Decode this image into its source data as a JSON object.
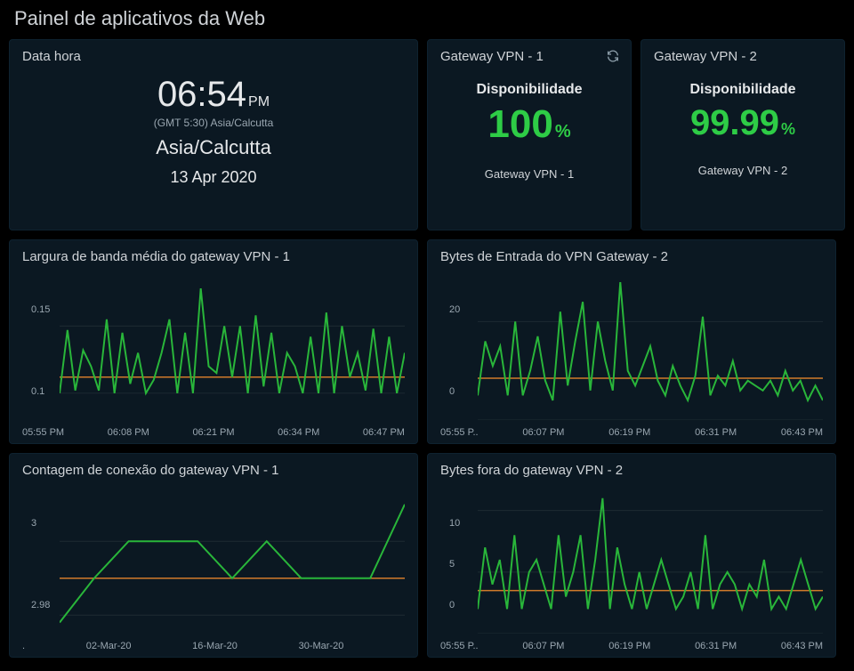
{
  "board_title": "Painel de aplicativos da Web",
  "clock": {
    "card_title": "Data hora",
    "time": "06:54",
    "ampm": "PM",
    "tz_line": "(GMT 5:30) Asia/Calcutta",
    "zone": "Asia/Calcutta",
    "date": "13 Apr 2020"
  },
  "stat1": {
    "card_title": "Gateway VPN - 1",
    "label": "Disponibilidade",
    "value": "100",
    "pct": "%",
    "footer": "Gateway VPN - 1",
    "big_font": "44px",
    "pct_font": "20px"
  },
  "stat2": {
    "card_title": "Gateway VPN - 2",
    "label": "Disponibilidade",
    "value": "99.99",
    "pct": "%",
    "footer": "Gateway VPN - 2",
    "big_font": "40px",
    "pct_font": "18px"
  },
  "chart_data": [
    {
      "id": "chart1",
      "type": "line",
      "title": "Largura de banda média do gateway VPN - 1",
      "x_ticks": [
        "05:55 PM",
        "06:08 PM",
        "06:21 PM",
        "06:34 PM",
        "06:47 PM"
      ],
      "y_ticks": [
        "0.15",
        "0.1"
      ],
      "ylim": [
        0.08,
        0.19
      ],
      "avg_line": 0.112,
      "values": [
        0.1,
        0.147,
        0.102,
        0.132,
        0.12,
        0.102,
        0.155,
        0.1,
        0.145,
        0.107,
        0.13,
        0.1,
        0.11,
        0.13,
        0.155,
        0.1,
        0.145,
        0.1,
        0.178,
        0.12,
        0.115,
        0.15,
        0.112,
        0.15,
        0.1,
        0.158,
        0.105,
        0.145,
        0.1,
        0.13,
        0.12,
        0.1,
        0.142,
        0.1,
        0.16,
        0.1,
        0.15,
        0.112,
        0.13,
        0.102,
        0.148,
        0.1,
        0.142,
        0.1,
        0.13
      ]
    },
    {
      "id": "chart2",
      "type": "line",
      "title": "Bytes de Entrada do VPN Gateway - 2",
      "x_ticks": [
        "05:55 P..",
        "06:07 PM",
        "06:19 PM",
        "06:31 PM",
        "06:43 PM"
      ],
      "y_ticks": [
        "20",
        "0"
      ],
      "ylim": [
        0,
        30
      ],
      "avg_line": 8.5,
      "values": [
        5,
        16,
        11,
        15,
        5,
        20,
        5,
        10,
        17,
        8,
        4,
        22,
        7,
        16,
        24,
        6,
        20,
        12,
        6,
        28,
        10,
        7,
        11,
        15,
        8,
        5,
        11,
        7,
        4,
        9,
        21,
        5,
        9,
        7,
        12,
        6,
        8,
        7,
        6,
        8,
        5,
        10,
        6,
        8,
        4,
        7,
        4
      ]
    },
    {
      "id": "chart3",
      "type": "line",
      "title": "Contagem de conexão do gateway VPN - 1",
      "x_ticks": [
        ".",
        "02-Mar-20",
        "16-Mar-20",
        "30-Mar-20",
        ""
      ],
      "y_ticks": [
        "3",
        "2.98"
      ],
      "ylim": [
        2.975,
        3.015
      ],
      "avg_line": 2.99,
      "values": [
        2.978,
        2.99,
        3.0,
        3.0,
        3.0,
        2.99,
        3.0,
        2.99,
        2.99,
        2.99,
        3.01
      ]
    },
    {
      "id": "chart4",
      "type": "line",
      "title": "Bytes fora do gateway VPN - 2",
      "x_ticks": [
        "05:55 P..",
        "06:07 PM",
        "06:19 PM",
        "06:31 PM",
        "06:43 PM"
      ],
      "y_ticks": [
        "10",
        "5",
        "0"
      ],
      "ylim": [
        0,
        12
      ],
      "avg_line": 3.5,
      "values": [
        2,
        7,
        4,
        6,
        2,
        8,
        2,
        5,
        6,
        4,
        2,
        8,
        3,
        5,
        8,
        2,
        6,
        11,
        2,
        7,
        4,
        2,
        5,
        2,
        4,
        6,
        4,
        2,
        3,
        5,
        2,
        8,
        2,
        4,
        5,
        4,
        2,
        4,
        3,
        6,
        2,
        3,
        2,
        4,
        6,
        4,
        2,
        3
      ]
    }
  ]
}
